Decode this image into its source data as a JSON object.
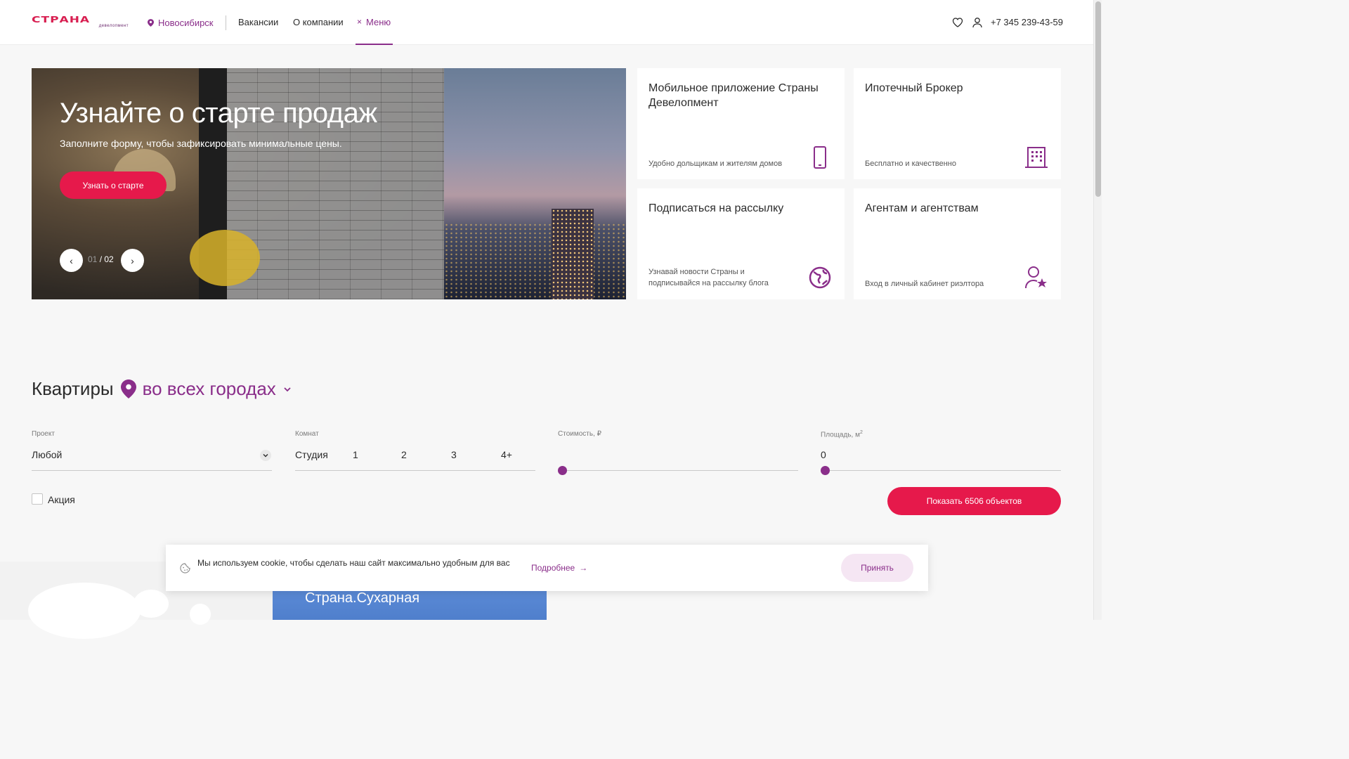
{
  "header": {
    "logo_text": "СТРАНА",
    "logo_sub": "девелопмент",
    "city": "Новосибирск",
    "nav": [
      "Вакансии",
      "О компании"
    ],
    "menu_label": "Меню",
    "menu_close_glyph": "×",
    "phone": "+7 345 239-43-59"
  },
  "hero": {
    "title": "Узнайте о старте продаж",
    "subtitle": "Заполните форму, чтобы зафиксировать минимальные цены.",
    "button": "Узнать о старте",
    "slide_current": "01",
    "slide_sep": " / ",
    "slide_total": "02",
    "prev_glyph": "‹",
    "next_glyph": "›"
  },
  "cards": [
    {
      "title": "Мобильное приложение Страны Девелопмент",
      "desc": "Удобно дольщикам и жителям домов",
      "icon": "phone-icon"
    },
    {
      "title": "Ипотечный Брокер",
      "desc": "Бесплатно и качественно",
      "icon": "building-icon"
    },
    {
      "title": "Подписаться на рассылку",
      "desc": "Узнавай новости Страны и подписывайся на рассылку блога",
      "icon": "globe-icon"
    },
    {
      "title": "Агентам и агентствам",
      "desc": "Вход в личный кабинет риэлтора",
      "icon": "agent-star-icon"
    }
  ],
  "filter": {
    "title": "Квартиры",
    "city_select": "во всех городах",
    "project_label": "Проект",
    "project_value": "Любой",
    "rooms_label": "Комнат",
    "rooms": [
      "Студия",
      "1",
      "2",
      "3",
      "4+"
    ],
    "price_label": "Стоимость, ₽",
    "area_label": "Площадь, м",
    "area_sup": "2",
    "area_value": "0",
    "promo_label": "Акция",
    "show_button": "Показать 6506 объектов"
  },
  "project_card": {
    "name": "Страна.Сухарная"
  },
  "cookie": {
    "text": "Мы используем cookie, чтобы сделать наш сайт максимально удобным для вас",
    "more": "Подробнее",
    "more_arrow": "→",
    "accept": "Принять"
  },
  "colors": {
    "accent": "#e6194b",
    "purple": "#8a2e8a",
    "logo_red": "#d81e50"
  }
}
